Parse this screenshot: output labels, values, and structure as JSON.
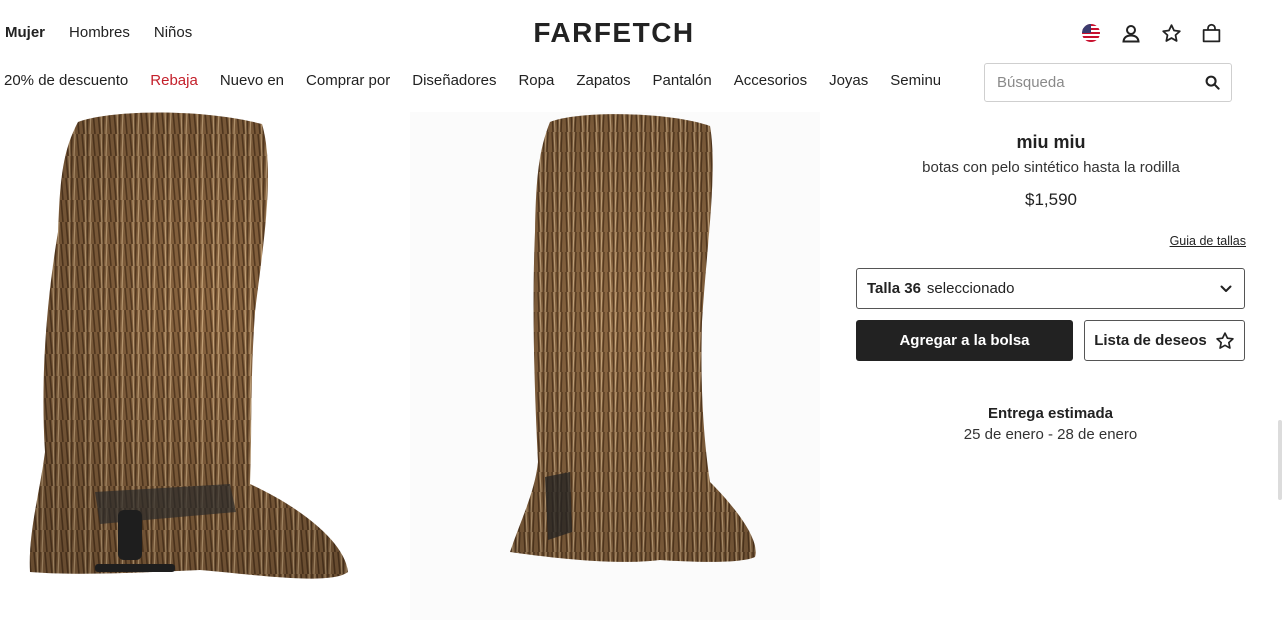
{
  "header": {
    "gender_nav": [
      "Mujer",
      "Hombres",
      "Niños"
    ],
    "logo": "FARFETCH",
    "icons": [
      "us-flag-icon",
      "account-icon",
      "wishlist-star-icon",
      "shopping-bag-icon"
    ]
  },
  "categories": [
    {
      "label": "20% de descuento"
    },
    {
      "label": "Rebaja",
      "color": "#c4202b"
    },
    {
      "label": "Nuevo en"
    },
    {
      "label": "Comprar por"
    },
    {
      "label": "Diseñadores"
    },
    {
      "label": "Ropa"
    },
    {
      "label": "Zapatos"
    },
    {
      "label": "Pantalón"
    },
    {
      "label": "Accesorios"
    },
    {
      "label": "Joyas"
    },
    {
      "label": "Seminue"
    }
  ],
  "search": {
    "placeholder": "Búsqueda"
  },
  "product": {
    "brand": "miu miu",
    "name": "botas con pelo sintético hasta la rodilla",
    "price": "$1,590",
    "size_guide": "Guia de tallas",
    "size_label": "Talla 36",
    "size_state": "seleccionado",
    "add_to_bag": "Agregar a la bolsa",
    "wishlist": "Lista de deseos",
    "delivery_title": "Entrega estimada",
    "delivery_dates": "25 de enero - 28 de enero"
  },
  "colors": {
    "primary": "#222222",
    "sale": "#c4202b",
    "fur_dark": "#5a3d22",
    "fur_light": "#c9a77c"
  }
}
